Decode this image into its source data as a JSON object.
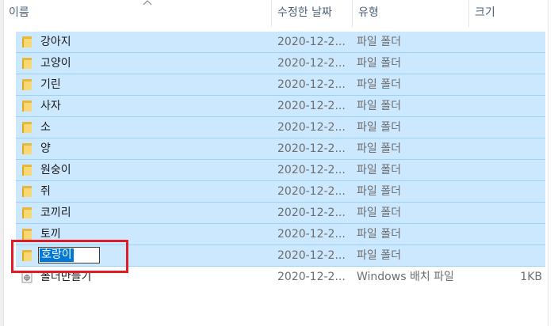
{
  "columns": {
    "name": "이름",
    "modified": "수정한 날짜",
    "type": "유형",
    "size": "크기"
  },
  "rows": [
    {
      "name": "강아지",
      "date": "2020-12-2...",
      "type": "파일 폴더",
      "size": ""
    },
    {
      "name": "고양이",
      "date": "2020-12-2...",
      "type": "파일 폴더",
      "size": ""
    },
    {
      "name": "기린",
      "date": "2020-12-2...",
      "type": "파일 폴더",
      "size": ""
    },
    {
      "name": "사자",
      "date": "2020-12-2...",
      "type": "파일 폴더",
      "size": ""
    },
    {
      "name": "소",
      "date": "2020-12-2...",
      "type": "파일 폴더",
      "size": ""
    },
    {
      "name": "양",
      "date": "2020-12-2...",
      "type": "파일 폴더",
      "size": ""
    },
    {
      "name": "원숭이",
      "date": "2020-12-2...",
      "type": "파일 폴더",
      "size": ""
    },
    {
      "name": "쥐",
      "date": "2020-12-2...",
      "type": "파일 폴더",
      "size": ""
    },
    {
      "name": "코끼리",
      "date": "2020-12-2...",
      "type": "파일 폴더",
      "size": ""
    },
    {
      "name": "토끼",
      "date": "2020-12-2...",
      "type": "파일 폴더",
      "size": ""
    }
  ],
  "rename_row": {
    "value": "호랑이",
    "date": "2020-12-2...",
    "type": "파일 폴더",
    "size": ""
  },
  "file_row": {
    "name": "폴더만들기",
    "date": "2020-12-2...",
    "type": "Windows 배치 파일",
    "size": "1KB"
  },
  "colors": {
    "selection": "#cce8ff",
    "selection_border": "#99d1ff",
    "highlight": "#e01b24",
    "edit_selection": "#0078d7"
  },
  "icons": {
    "folder": "folder-icon",
    "batch": "batch-file-icon",
    "sort": "sort-ascending-icon"
  }
}
